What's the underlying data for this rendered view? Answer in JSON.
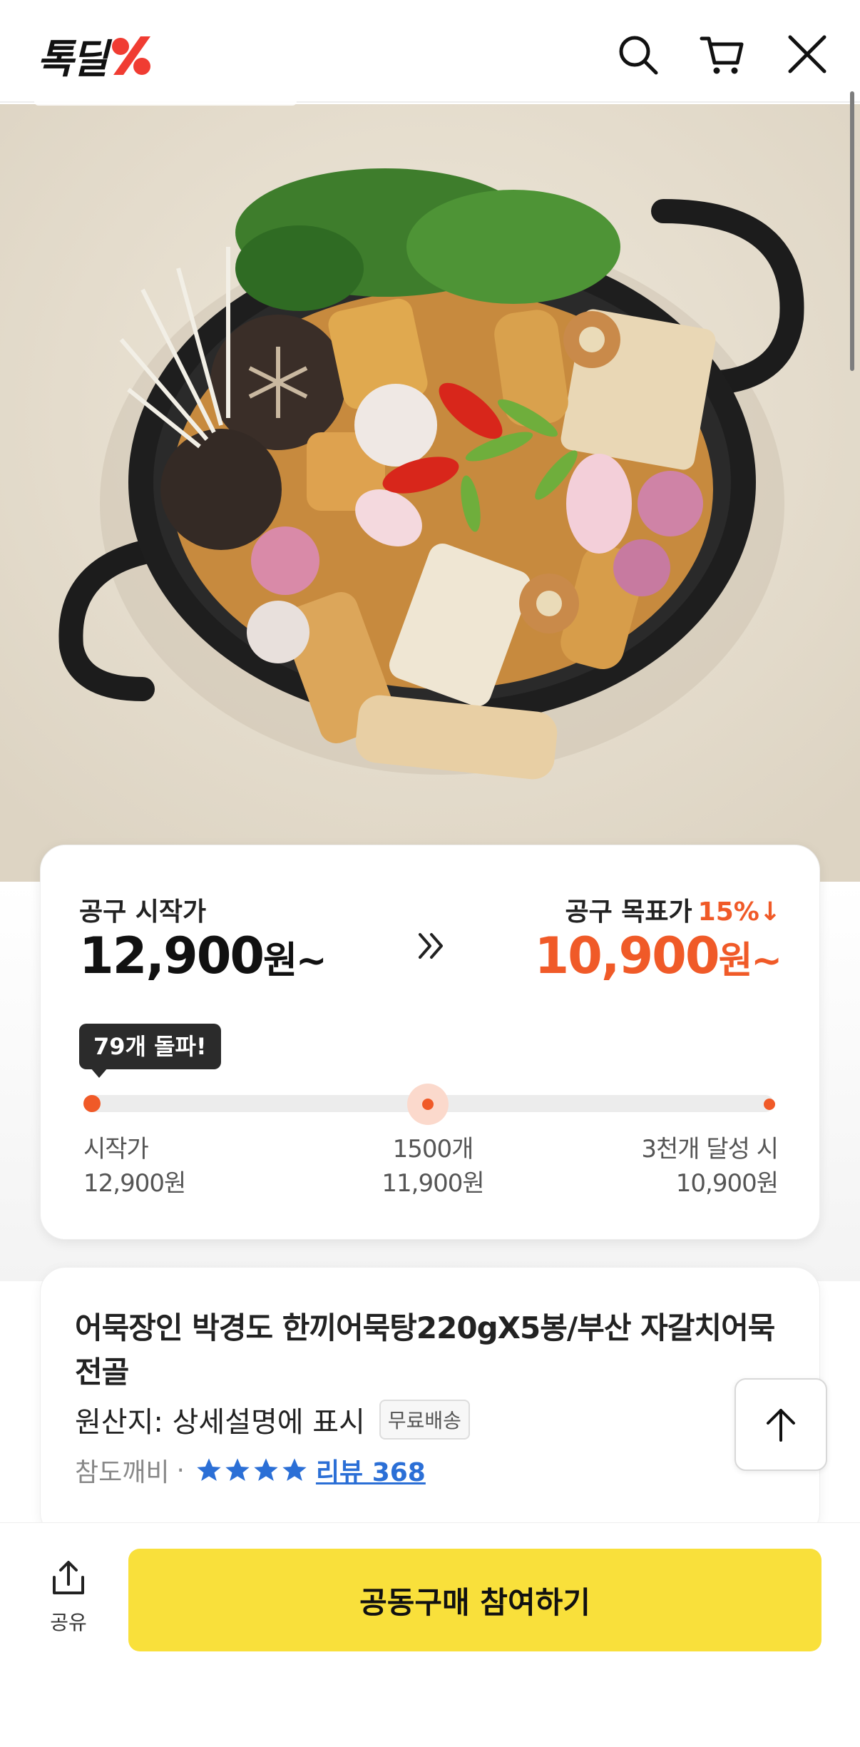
{
  "header": {
    "logo_text": "톡딜",
    "logo_mark": "%",
    "icons": [
      "search-icon",
      "cart-icon",
      "close-icon"
    ]
  },
  "price_card": {
    "start_label": "공구 시작가",
    "start_price": "12,900",
    "start_unit": "원~",
    "target_label": "공구 목표가",
    "target_discount": "15%↓",
    "target_price": "10,900",
    "target_unit": "원~",
    "progress_badge": "79개 돌파!",
    "progress_fraction": 0.01,
    "milestones": [
      {
        "line1": "시작가",
        "line2": "12,900원"
      },
      {
        "line1": "1500개",
        "line2": "11,900원"
      },
      {
        "line1": "3천개 달성 시",
        "line2": "10,900원"
      }
    ]
  },
  "product": {
    "title": "어묵장인 박경도 한끼어묵탕220gX5봉/부산 자갈치어묵전골",
    "origin": "원산지: 상세설명에 표시",
    "badge": "무료배송",
    "seller": "참도깨비",
    "separator": "·",
    "stars": 4,
    "review_label": "리뷰 368"
  },
  "bottom_bar": {
    "share_label": "공유",
    "join_button": "공동구매 참여하기"
  },
  "colors": {
    "accent": "#f05a28",
    "cta": "#f9e03b",
    "link": "#2b6fd6"
  }
}
